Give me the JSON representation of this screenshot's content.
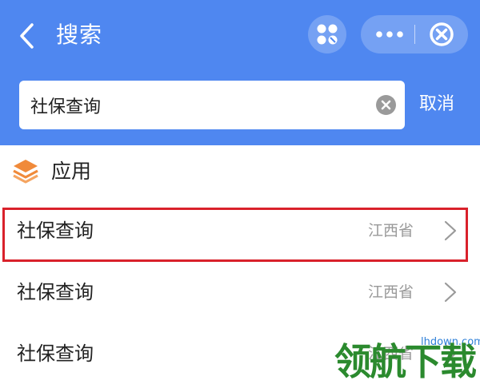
{
  "header": {
    "title": "搜索",
    "back_icon": "chevron-left-icon",
    "mini_program_icon": "mini-program-icon",
    "more_icon": "more-dots-icon",
    "close_icon": "close-circle-icon",
    "background_color": "#4f87f0"
  },
  "search": {
    "value": "社保查询",
    "clear_icon": "clear-icon",
    "cancel_label": "取消"
  },
  "section": {
    "title": "应用",
    "icon": "layers-icon",
    "icon_color": "#f08a3a"
  },
  "results": [
    {
      "name": "社保查询",
      "region": "江西省",
      "highlighted": true
    },
    {
      "name": "社保查询",
      "region": "江西省",
      "highlighted": false
    },
    {
      "name": "社保查询",
      "region": "江西省",
      "highlighted": false
    }
  ],
  "highlight_color": "#d9212b",
  "watermark": {
    "text": "领航下载",
    "url": "lhdown.com"
  }
}
